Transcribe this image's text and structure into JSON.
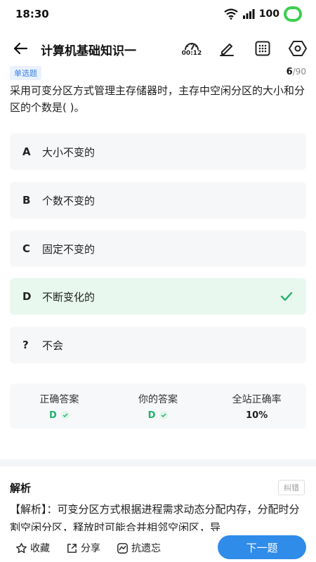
{
  "status": {
    "time": "18:30",
    "battery": "100"
  },
  "nav": {
    "title": "计算机基础知识一",
    "timer": "00:12"
  },
  "question": {
    "type": "单选题",
    "current": "6",
    "total": "/90",
    "text": "采用可变分区方式管理主存储器时，主存中空闲分区的大小和分区的个数是( )。"
  },
  "options": [
    {
      "letter": "A",
      "text": "大小不变的"
    },
    {
      "letter": "B",
      "text": "个数不变的"
    },
    {
      "letter": "C",
      "text": "固定不变的"
    },
    {
      "letter": "D",
      "text": "不断变化的"
    },
    {
      "letter": "?",
      "text": "不会"
    }
  ],
  "stats": {
    "correct_label": "正确答案",
    "correct_value": "D",
    "your_label": "你的答案",
    "your_value": "D",
    "rate_label": "全站正确率",
    "rate_value": "10%"
  },
  "analysis": {
    "title": "解析",
    "report": "纠错",
    "text": "【解析】：可变分区方式根据进程需求动态分配内存，分配时分割空闲分区，释放时可能合并相邻空闲区，导"
  },
  "bottom": {
    "favorite": "收藏",
    "share": "分享",
    "forget": "抗遗忘",
    "next": "下一题"
  },
  "colors": {
    "accent": "#2f8ce8",
    "correct": "#1fb26b",
    "battery": "#3ccf4e"
  }
}
